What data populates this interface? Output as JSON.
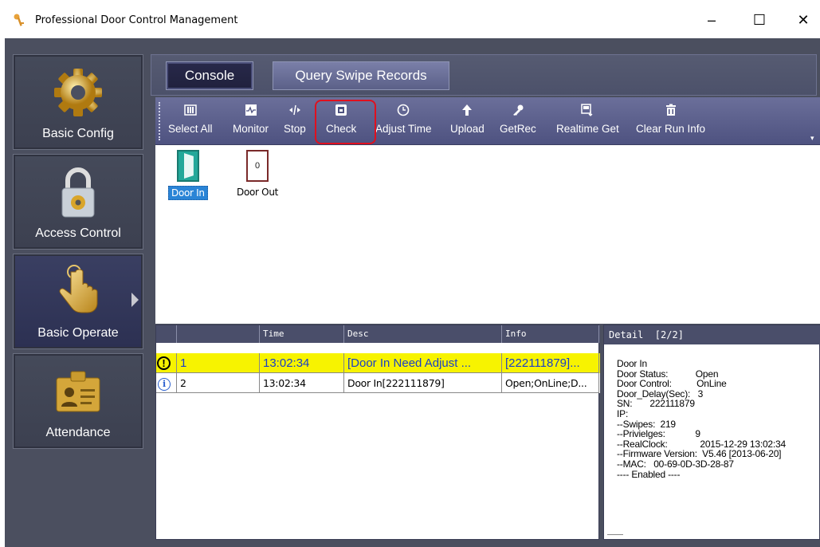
{
  "window": {
    "title": "Professional Door Control Management",
    "controls": {
      "minimize": "–",
      "maximize": "☐",
      "close": "✕"
    }
  },
  "nav": [
    {
      "label": "Basic Config",
      "icon": "gear-icon"
    },
    {
      "label": "Access Control",
      "icon": "padlock-icon"
    },
    {
      "label": "Basic Operate",
      "icon": "hand-pointer-icon"
    },
    {
      "label": "Attendance",
      "icon": "id-card-icon"
    }
  ],
  "tabs": {
    "console": "Console",
    "query": "Query Swipe Records"
  },
  "toolbar": {
    "select_all": "Select All",
    "monitor": "Monitor",
    "stop": "Stop",
    "check": "Check",
    "adjust_time": "Adjust Time",
    "upload": "Upload",
    "getrec": "GetRec",
    "realtime_get": "Realtime Get",
    "clear_run_info": "Clear Run Info",
    "overflow": "▾"
  },
  "doors": [
    {
      "name": "Door In"
    },
    {
      "name": "Door Out",
      "number": "0"
    }
  ],
  "log": {
    "headers": [
      "",
      "",
      "Time",
      "Desc",
      "Info"
    ],
    "rows": [
      {
        "type": "warning",
        "index": "1",
        "time": "13:02:34",
        "desc": "[Door In Need Adjust ...",
        "info": "[222111879]..."
      },
      {
        "type": "info",
        "index": "2",
        "time": "13:02:34",
        "desc": "Door In[222111879]",
        "info": "Open;OnLine;D..."
      }
    ]
  },
  "detail": {
    "header": "Detail  [2/2]",
    "lines": [
      "Door In",
      "Door Status:           Open",
      "Door Control:          OnLine",
      "Door_Delay(Sec):   3",
      "SN:       222111879",
      "IP:",
      "--Swipes:  219",
      "--Privielges:            9",
      "--RealClock:             2015-12-29 13:02:34",
      "--Firmware Version:  V5.46 [2013-06-20]",
      "--MAC:   00-69-0D-3D-28-87",
      "---- Enabled ----"
    ]
  },
  "colors": {
    "frame": "#4b4f5f",
    "toolbar": "#5b5f8c",
    "warning_row": "#f7f300",
    "check_highlight": "#e0101e",
    "selected_door": "#2a84d6"
  }
}
